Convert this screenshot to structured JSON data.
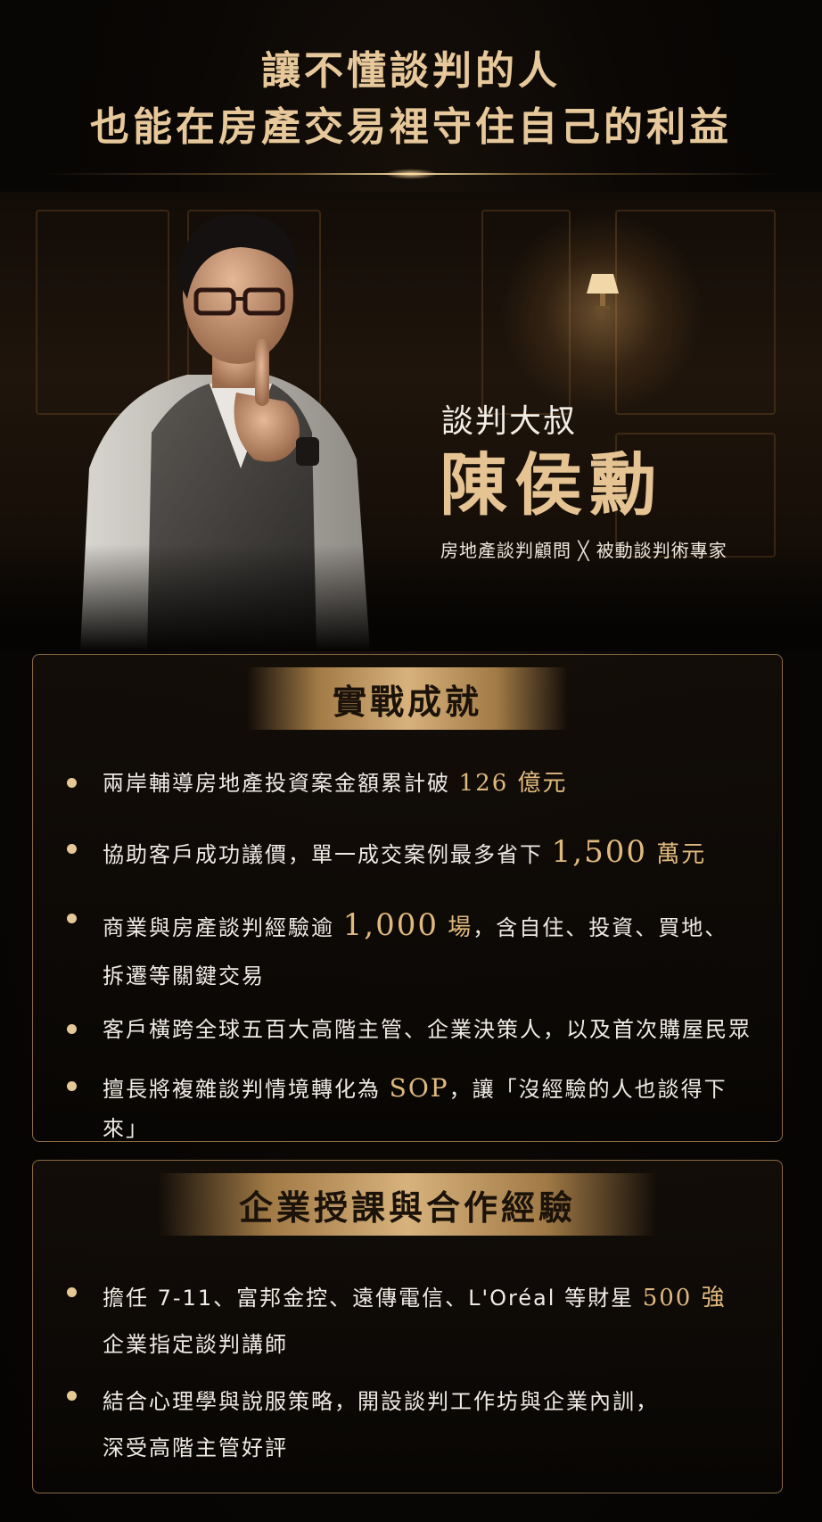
{
  "headline": {
    "line1": "讓不懂談判的人",
    "line2": "也能在房產交易裡守住自己的利益"
  },
  "profile": {
    "nickname": "談判大叔",
    "name": "陳侯勳",
    "title": "房地產談判顧問 ╳ 被動談判術專家"
  },
  "achievements": {
    "heading": "實戰成就",
    "items": [
      {
        "pre": "兩岸輔導房地產投資案金額累計破 ",
        "hl": "126 億元",
        "post": ""
      },
      {
        "pre": "協助客戶成功議價，單一成交案例最多省下 ",
        "hl": "1,500",
        "hl2": " 萬元",
        "post": ""
      },
      {
        "pre": "商業與房產談判經驗逾 ",
        "hl": "1,000",
        "hl2": " 場",
        "post": "，含自住、投資、買地、",
        "line2": "拆遷等關鍵交易"
      },
      {
        "pre": "客戶橫跨全球五百大高階主管、企業決策人，以及首次購屋民眾",
        "hl": "",
        "post": ""
      },
      {
        "pre": "擅長將複雜談判情境轉化為 ",
        "hl": "SOP",
        "post": "，讓「沒經驗的人也談得下來」"
      }
    ]
  },
  "corporate": {
    "heading": "企業授課與合作經驗",
    "items": [
      {
        "pre": "擔任 7-11、富邦金控、遠傳電信、L'Oréal 等財星 ",
        "hl": "500 強",
        "line2": "企業指定談判講師"
      },
      {
        "pre": "結合心理學與說服策略，開設談判工作坊與企業內訓，",
        "line2": "深受高階主管好評"
      }
    ]
  },
  "colors": {
    "gold": "#e5c393",
    "background": "#050403",
    "card_border": "#8a6a42"
  }
}
